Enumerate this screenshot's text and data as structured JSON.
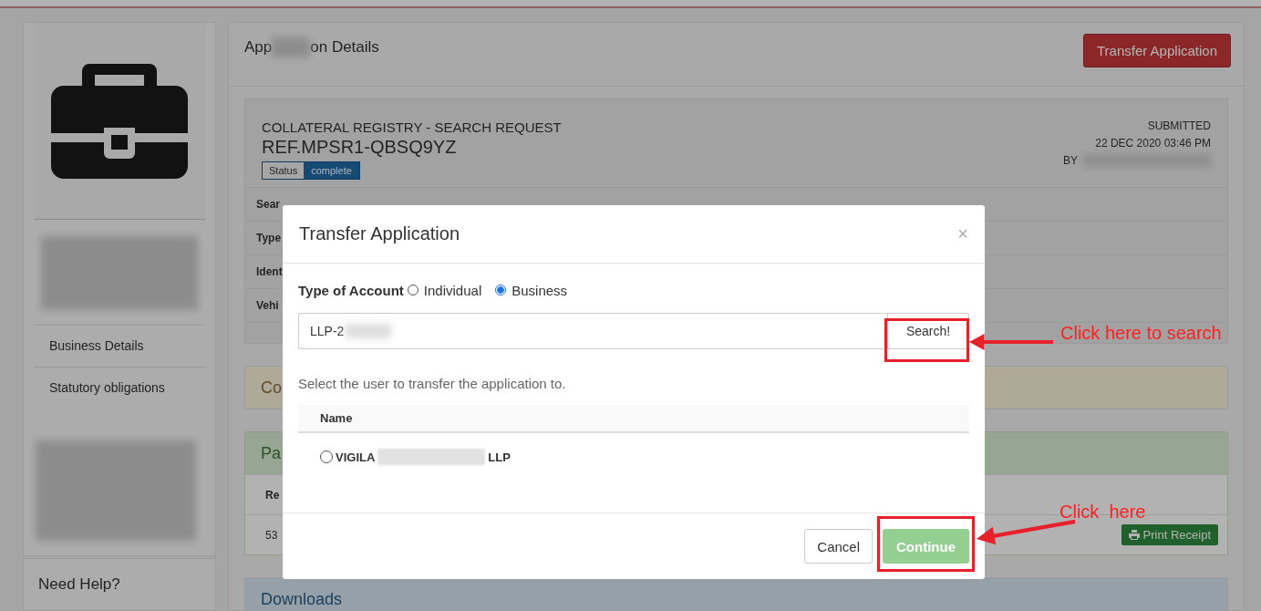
{
  "page": {
    "title_start": "App",
    "title_end": "on Details",
    "header_button": "Transfer Application"
  },
  "sidebar": {
    "items": [
      {
        "label": "Business Details"
      },
      {
        "label": "Statutory obligations"
      }
    ],
    "help_title": "Need Help?"
  },
  "request": {
    "category": "COLLATERAL REGISTRY - SEARCH REQUEST",
    "reference": "REF.MPSR1-QBSQ9YZ",
    "status_label": "Status",
    "status_value": "complete",
    "submitted_label": "SUBMITTED",
    "submitted_date": "22 DEC 2020 03:46 PM",
    "by_label": "BY",
    "fields": [
      "Sear",
      "Type",
      "Ident",
      "Vehi"
    ]
  },
  "sections": [
    {
      "kind": "warning",
      "title": "Co"
    },
    {
      "kind": "success",
      "title": "Pa",
      "column": "Re",
      "cell": "53",
      "button": "Print Receipt"
    },
    {
      "kind": "info",
      "title": "Downloads"
    }
  ],
  "modal": {
    "title": "Transfer Application",
    "close": "×",
    "account_label": "Type of Account",
    "account_options": [
      {
        "label": "Individual",
        "selected": false
      },
      {
        "label": "Business",
        "selected": true
      }
    ],
    "search_value": "LLP-2",
    "search_button": "Search!",
    "hint": "Select the user to transfer the application to.",
    "column": "Name",
    "rows": [
      {
        "name_start": "VIGILA",
        "name_end": "LLP",
        "selected": false
      }
    ],
    "cancel": "Cancel",
    "continue": "Continue",
    "continue_disabled": true
  },
  "annotations": [
    {
      "kind": "search",
      "text": "Click here to search"
    },
    {
      "kind": "continue",
      "text": "Click  here"
    }
  ]
}
